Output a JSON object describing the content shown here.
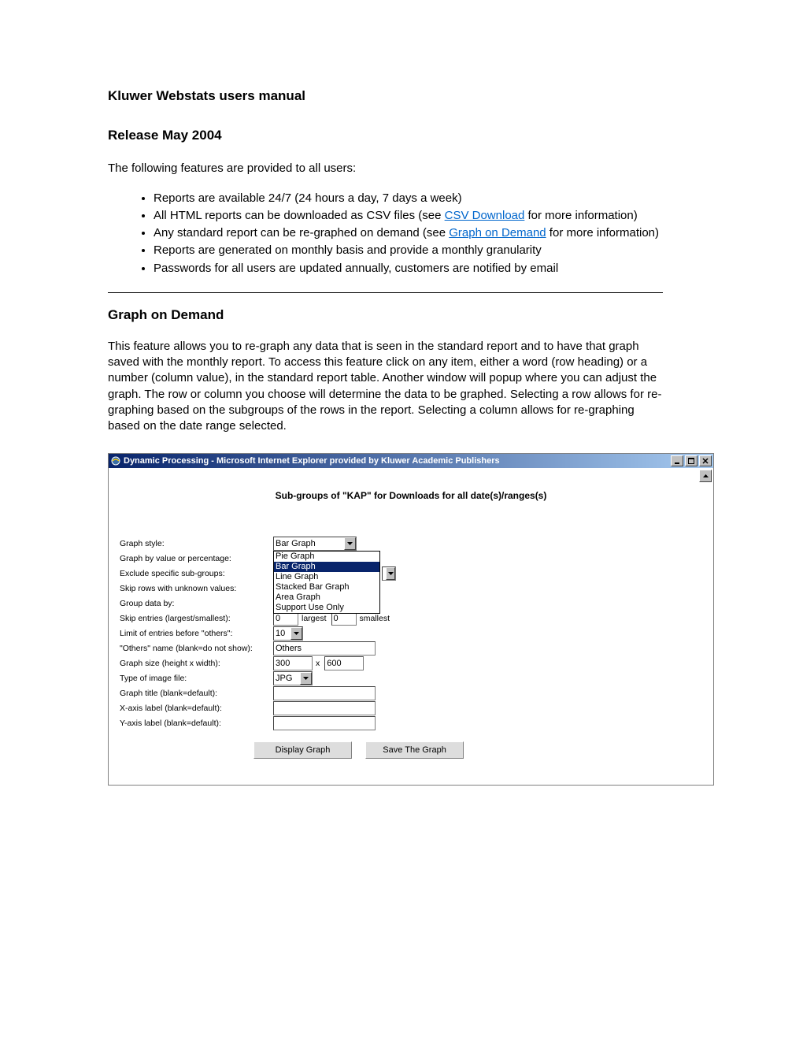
{
  "doc": {
    "title": "Kluwer Webstats users manual",
    "release": "Release May 2004",
    "intro": "The following features are provided to all users:",
    "features": {
      "f1": "Reports are available 24/7 (24 hours a day, 7 days a week)",
      "f2a": "All HTML reports can be downloaded as CSV files (see ",
      "f2link": "CSV Download",
      "f2b": " for more information)",
      "f3a": "Any standard report can be re-graphed on demand (see ",
      "f3link": "Graph on Demand",
      "f3b": " for more information)",
      "f4": "Reports are generated on monthly basis and provide a monthly granularity",
      "f5": "Passwords for all users are updated annually, customers are notified by email"
    },
    "section_title": "Graph on Demand",
    "section_body": "This feature allows you to re-graph any data that is seen in the standard report and to have that graph saved with the monthly report. To access this feature click on any item, either a word (row heading) or a number (column value), in the standard report table. Another window will popup where you can adjust the graph. The row or column you choose will determine the data to be graphed. Selecting a row allows for re-graphing based on the subgroups of the rows in the report. Selecting a column allows for re-graphing based on the date range selected."
  },
  "window": {
    "title": "Dynamic Processing - Microsoft Internet Explorer provided by Kluwer Academic Publishers",
    "heading": "Sub-groups of \"KAP\" for Downloads for all date(s)/ranges(s)",
    "labels": {
      "graph_style": "Graph style:",
      "graph_by": "Graph by value or percentage:",
      "exclude": "Exclude specific sub-groups:",
      "skip_unknown": "Skip rows with unknown values:",
      "group_by": "Group data by:",
      "skip_entries": "Skip entries (largest/smallest):",
      "limit": "Limit of entries before \"others\":",
      "others_name": "\"Others\" name (blank=do not show):",
      "size": "Graph size (height x width):",
      "image_type": "Type of image file:",
      "graph_title": "Graph title (blank=default):",
      "xaxis": "X-axis label (blank=default):",
      "yaxis": "Y-axis label (blank=default):",
      "largest": "largest",
      "smallest": "smallest",
      "size_x": "x"
    },
    "values": {
      "graph_style_selected": "Bar Graph",
      "graph_style_options": {
        "o0": "Pie Graph",
        "o1": "Bar Graph",
        "o2": "Line Graph",
        "o3": "Stacked Bar Graph",
        "o4": "Area Graph",
        "o5": "Support Use Only"
      },
      "skip_largest": "0",
      "skip_smallest": "0",
      "limit": "10",
      "others_name": "Others",
      "size_h": "300",
      "size_w": "600",
      "image_type": "JPG",
      "graph_title": "",
      "xaxis": "",
      "yaxis": ""
    },
    "buttons": {
      "display": "Display Graph",
      "save": "Save The Graph"
    }
  }
}
